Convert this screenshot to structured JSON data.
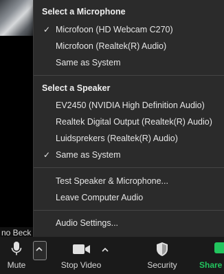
{
  "background": {
    "participant_name": "no Beck"
  },
  "menu": {
    "microphone_title": "Select a Microphone",
    "microphones": [
      {
        "label": "Microfoon (HD Webcam C270)",
        "checked": true
      },
      {
        "label": "Microfoon (Realtek(R) Audio)",
        "checked": false
      },
      {
        "label": "Same as System",
        "checked": false
      }
    ],
    "speaker_title": "Select a Speaker",
    "speakers": [
      {
        "label": "EV2450 (NVIDIA High Definition Audio)",
        "checked": false
      },
      {
        "label": "Realtek Digital Output (Realtek(R) Audio)",
        "checked": false
      },
      {
        "label": "Luidsprekers (Realtek(R) Audio)",
        "checked": false
      },
      {
        "label": "Same as System",
        "checked": true
      }
    ],
    "test_label": "Test Speaker & Microphone...",
    "leave_label": "Leave Computer Audio",
    "settings_label": "Audio Settings...",
    "check_glyph": "✓"
  },
  "toolbar": {
    "mute_label": "Mute",
    "stop_video_label": "Stop Video",
    "security_label": "Security",
    "share_label": "Share S",
    "share_color": "#22c55e"
  }
}
